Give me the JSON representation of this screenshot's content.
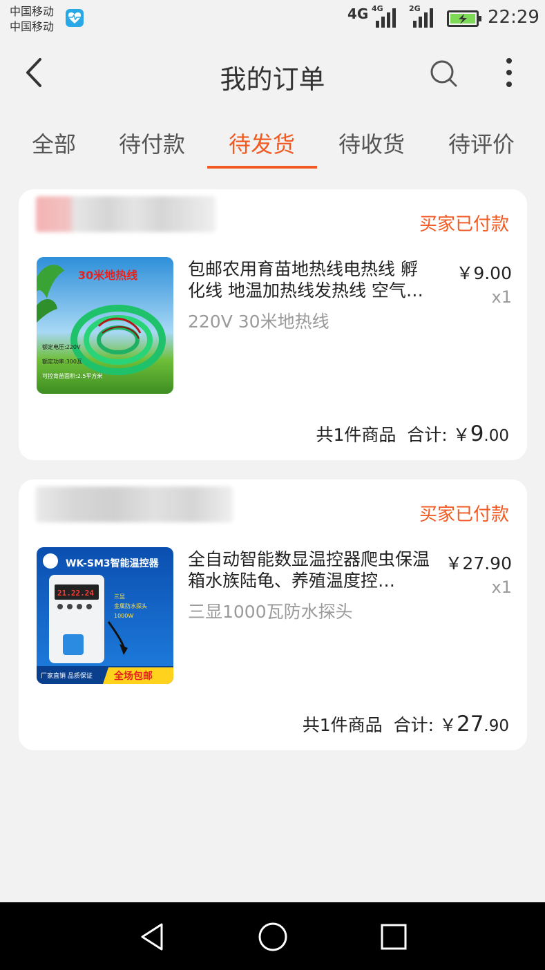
{
  "status_bar": {
    "carrier1": "中国移动",
    "carrier2": "中国移动",
    "network_main": "4G",
    "signal1_label": "4G",
    "signal2_label": "2G",
    "time": "22:29",
    "battery_icon": "battery-charging-icon",
    "health_icon": "health-app-icon"
  },
  "header": {
    "title": "我的订单",
    "back_icon": "back-arrow-icon",
    "search_icon": "search-icon",
    "more_icon": "more-vertical-icon"
  },
  "tabs": [
    {
      "label": "全部",
      "active": false
    },
    {
      "label": "待付款",
      "active": false
    },
    {
      "label": "待发货",
      "active": true
    },
    {
      "label": "待收货",
      "active": false
    },
    {
      "label": "待评价",
      "active": false
    }
  ],
  "orders": [
    {
      "status": "买家已付款",
      "product_title": "包邮农用育苗地热线电热线 孵化线 地温加热线发热线 空气…",
      "product_spec": "220V 30米地热线",
      "price": "￥9.00",
      "quantity": "x1",
      "summary_count": "共1件商品",
      "summary_label": "合计:",
      "summary_currency": "￥",
      "summary_int": "9",
      "summary_dec": ".00",
      "thumb": {
        "banner": "30米地热线",
        "line1": "额定电压:220V",
        "line2": "额定功率:300瓦",
        "line3": "可控育苗面积:2.5平方米"
      }
    },
    {
      "status": "买家已付款",
      "product_title": "全自动智能数显温控器爬虫保温箱水族陆龟、养殖温度控…",
      "product_spec": "三显1000瓦防水探头",
      "price": "￥27.90",
      "quantity": "x1",
      "summary_count": "共1件商品",
      "summary_label": "合计:",
      "summary_currency": "￥",
      "summary_int": "27",
      "summary_dec": ".90",
      "thumb": {
        "banner": "WK-SM3智能温控器",
        "display": "21.22.24",
        "side1": "三显",
        "side2": "金属防水探头",
        "side3": "1000W",
        "footer_left": "厂家直销 品质保证",
        "footer_right": "全场包邮"
      }
    }
  ],
  "navbar": {
    "back": "nav-back-icon",
    "home": "nav-home-icon",
    "recent": "nav-recent-icon"
  },
  "colors": {
    "accent": "#f15a22",
    "background": "#f2f2f2",
    "card": "#ffffff",
    "muted": "#9a9a9a"
  }
}
